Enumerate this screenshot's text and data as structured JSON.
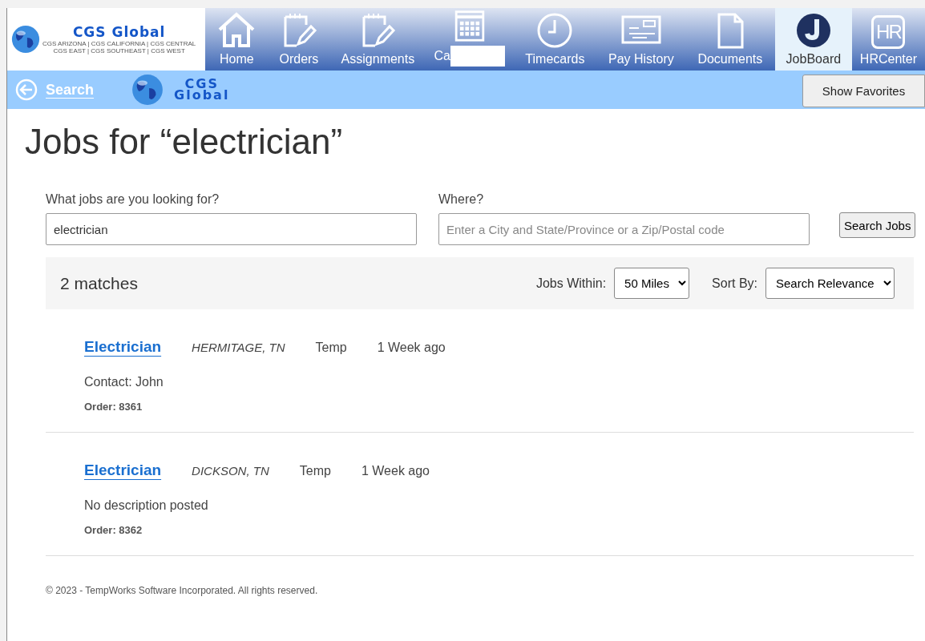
{
  "header": {
    "logo": {
      "name": "CGS Global",
      "lines": [
        "CGS ARIZONA | CGS CALIFORNIA | CGS CENTRAL",
        "CGS EAST | CGS SOUTHEAST | CGS WEST"
      ]
    },
    "nav": [
      {
        "label": "Home",
        "kind": "home",
        "selected": false
      },
      {
        "label": "Orders",
        "kind": "note",
        "selected": false
      },
      {
        "label": "Assignments",
        "kind": "note",
        "selected": false
      },
      {
        "label": "Ca",
        "kind": "calendar",
        "selected": false,
        "redacted": true
      },
      {
        "label": "Timecards",
        "kind": "clock",
        "selected": false
      },
      {
        "label": "Pay History",
        "kind": "check",
        "selected": false
      },
      {
        "label": "Documents",
        "kind": "document",
        "selected": false
      },
      {
        "label": "JobBoard",
        "kind": "jobboard",
        "selected": true
      },
      {
        "label": "HRCenter",
        "kind": "badge",
        "icon_text": "HR",
        "selected": false
      }
    ]
  },
  "subbar": {
    "back_link": "Search",
    "logo_lines": [
      "CGS",
      "Global"
    ],
    "favorites_button": "Show Favorites"
  },
  "title": "Jobs for “electrician”",
  "search": {
    "what_label": "What jobs are you looking for?",
    "what_value": "electrician",
    "where_label": "Where?",
    "where_placeholder": "Enter a City and State/Province or a Zip/Postal code",
    "button": "Search Jobs"
  },
  "results": {
    "count": "2 matches",
    "within_label": "Jobs Within:",
    "within": "50 Miles",
    "sort_label": "Sort By:",
    "sort": "Search Relevance"
  },
  "jobs": [
    {
      "title": "Electrician",
      "location": "HERMITAGE, TN",
      "type": "Temp",
      "posted": "1 Week ago",
      "description": "Contact: John",
      "order": "Order: 8361"
    },
    {
      "title": "Electrician",
      "location": "DICKSON, TN",
      "type": "Temp",
      "posted": "1 Week ago",
      "description": "No description posted",
      "order": "Order: 8362"
    }
  ],
  "footer": "© 2023 - TempWorks Software Incorporated. All rights reserved."
}
